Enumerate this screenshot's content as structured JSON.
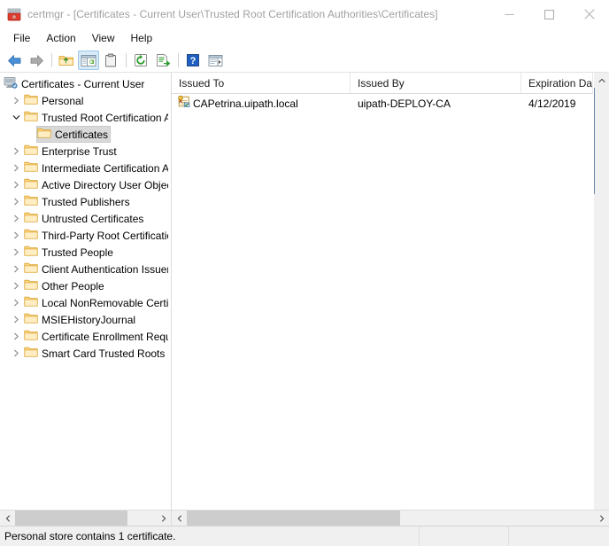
{
  "window": {
    "title": "certmgr - [Certificates - Current User\\Trusted Root Certification Authorities\\Certificates]",
    "app_icon": "certmgr-icon",
    "controls": {
      "minimize": "minimize-button",
      "maximize": "maximize-button",
      "close": "close-button"
    }
  },
  "menubar": {
    "items": [
      {
        "label": "File"
      },
      {
        "label": "Action"
      },
      {
        "label": "View"
      },
      {
        "label": "Help"
      }
    ]
  },
  "toolbar": {
    "buttons": [
      {
        "name": "back-icon",
        "title": "Back"
      },
      {
        "name": "forward-icon",
        "title": "Forward"
      },
      {
        "name": "separator",
        "title": ""
      },
      {
        "name": "up-folder-icon",
        "title": "Up One Level"
      },
      {
        "name": "show-hide-tree-icon",
        "title": "Show/Hide Console Tree",
        "active": true
      },
      {
        "name": "properties-clipboard-icon",
        "title": "Properties"
      },
      {
        "name": "separator",
        "title": ""
      },
      {
        "name": "refresh-icon",
        "title": "Refresh"
      },
      {
        "name": "export-list-icon",
        "title": "Export List"
      },
      {
        "name": "separator",
        "title": ""
      },
      {
        "name": "help-icon",
        "title": "Help"
      },
      {
        "name": "show-action-pane-icon",
        "title": "Show/Hide Action Pane"
      }
    ]
  },
  "tree": {
    "root": {
      "label": "Certificates - Current User",
      "icon": "console-root-icon"
    },
    "items": [
      {
        "label": "Personal",
        "state": "collapsed",
        "indent": 1,
        "selected": false
      },
      {
        "label": "Trusted Root Certification Aut",
        "state": "expanded",
        "indent": 1,
        "selected": false
      },
      {
        "label": "Certificates",
        "state": "leaf",
        "indent": 2,
        "selected": true
      },
      {
        "label": "Enterprise Trust",
        "state": "collapsed",
        "indent": 1,
        "selected": false
      },
      {
        "label": "Intermediate Certification Aut",
        "state": "collapsed",
        "indent": 1,
        "selected": false
      },
      {
        "label": "Active Directory User Object",
        "state": "collapsed",
        "indent": 1,
        "selected": false
      },
      {
        "label": "Trusted Publishers",
        "state": "collapsed",
        "indent": 1,
        "selected": false
      },
      {
        "label": "Untrusted Certificates",
        "state": "collapsed",
        "indent": 1,
        "selected": false
      },
      {
        "label": "Third-Party Root Certification",
        "state": "collapsed",
        "indent": 1,
        "selected": false
      },
      {
        "label": "Trusted People",
        "state": "collapsed",
        "indent": 1,
        "selected": false
      },
      {
        "label": "Client Authentication Issuers",
        "state": "collapsed",
        "indent": 1,
        "selected": false
      },
      {
        "label": "Other People",
        "state": "collapsed",
        "indent": 1,
        "selected": false
      },
      {
        "label": "Local NonRemovable Certifica",
        "state": "collapsed",
        "indent": 1,
        "selected": false
      },
      {
        "label": "MSIEHistoryJournal",
        "state": "collapsed",
        "indent": 1,
        "selected": false
      },
      {
        "label": "Certificate Enrollment Reques",
        "state": "collapsed",
        "indent": 1,
        "selected": false
      },
      {
        "label": "Smart Card Trusted Roots",
        "state": "collapsed",
        "indent": 1,
        "selected": false
      }
    ]
  },
  "list": {
    "columns": [
      {
        "label": "Issued To"
      },
      {
        "label": "Issued By"
      },
      {
        "label": "Expiration Dat"
      }
    ],
    "rows": [
      {
        "icon": "certificate-icon",
        "issued_to": "CAPetrina.uipath.local",
        "issued_by": "uipath-DEPLOY-CA",
        "expiration_date": "4/12/2019"
      }
    ]
  },
  "statusbar": {
    "message": "Personal store contains 1 certificate.",
    "panel2": "",
    "panel3": ""
  },
  "colors": {
    "folder": "#ffd98a",
    "folder_edge": "#e0a72a",
    "accent_selection": "#d9d9d9",
    "toolbar_active": "#d7eaf8",
    "title_text": "#a0a0a0",
    "scrollbar_thumb": "#cdcdcd",
    "scrollbar_track": "#f0f0f0"
  }
}
